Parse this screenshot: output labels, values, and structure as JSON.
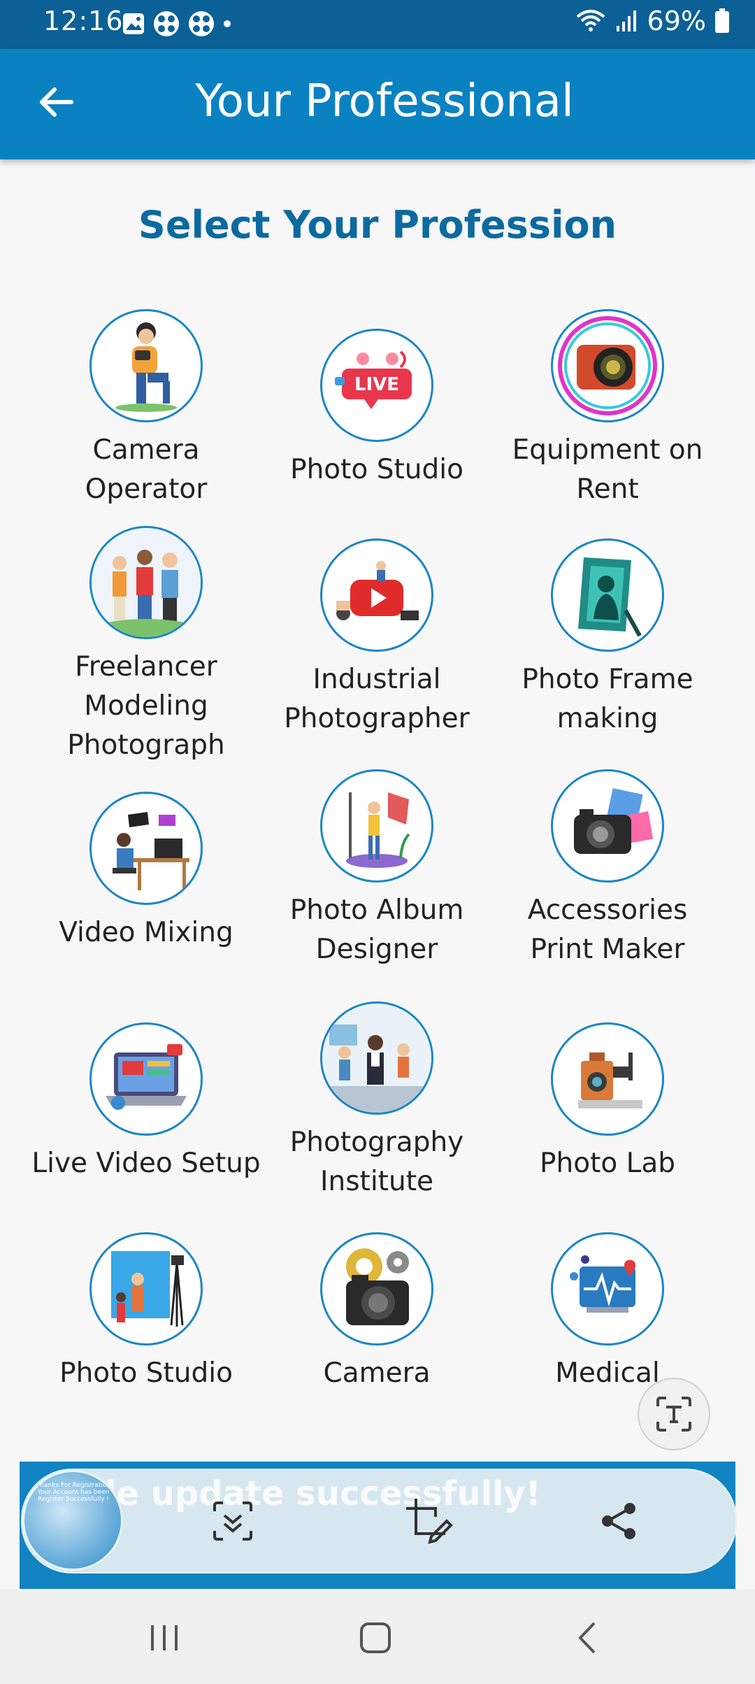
{
  "status_bar": {
    "time": "12:16",
    "battery": "69%"
  },
  "app_bar": {
    "title": "Your Professional"
  },
  "section_title": "Select Your Profession",
  "professions": [
    {
      "label": "Camera Operator",
      "icon": "camera-operator-icon"
    },
    {
      "label": "Photo Studio",
      "icon": "live-icon"
    },
    {
      "label": "Equipment on Rent",
      "icon": "camera-icon"
    },
    {
      "label": "Freelancer Modeling Photograph",
      "icon": "photographers-group-icon"
    },
    {
      "label": "Industrial Photographer",
      "icon": "video-play-icon"
    },
    {
      "label": "Photo Frame making",
      "icon": "photo-frame-icon"
    },
    {
      "label": "Video Mixing",
      "icon": "video-editor-desk-icon"
    },
    {
      "label": "Photo Album Designer",
      "icon": "album-designer-icon"
    },
    {
      "label": "Accessories Print Maker",
      "icon": "camera-prints-icon"
    },
    {
      "label": "Live Video Setup",
      "icon": "laptop-video-icon"
    },
    {
      "label": "Photography Institute",
      "icon": "classroom-icon"
    },
    {
      "label": "Photo Lab",
      "icon": "vintage-camera-icon"
    },
    {
      "label": "Photo Studio",
      "icon": "studio-backdrop-icon"
    },
    {
      "label": "Camera",
      "icon": "camera-gears-icon"
    },
    {
      "label": "Medical",
      "icon": "heart-monitor-icon"
    }
  ],
  "toast": {
    "text": "le update successfully!",
    "thumbnail_text": "Thanks For Registration Your Account has been Register Successfully !"
  },
  "colors": {
    "primary": "#0a82c2",
    "status": "#0b6196",
    "title": "#0b6aa0"
  }
}
